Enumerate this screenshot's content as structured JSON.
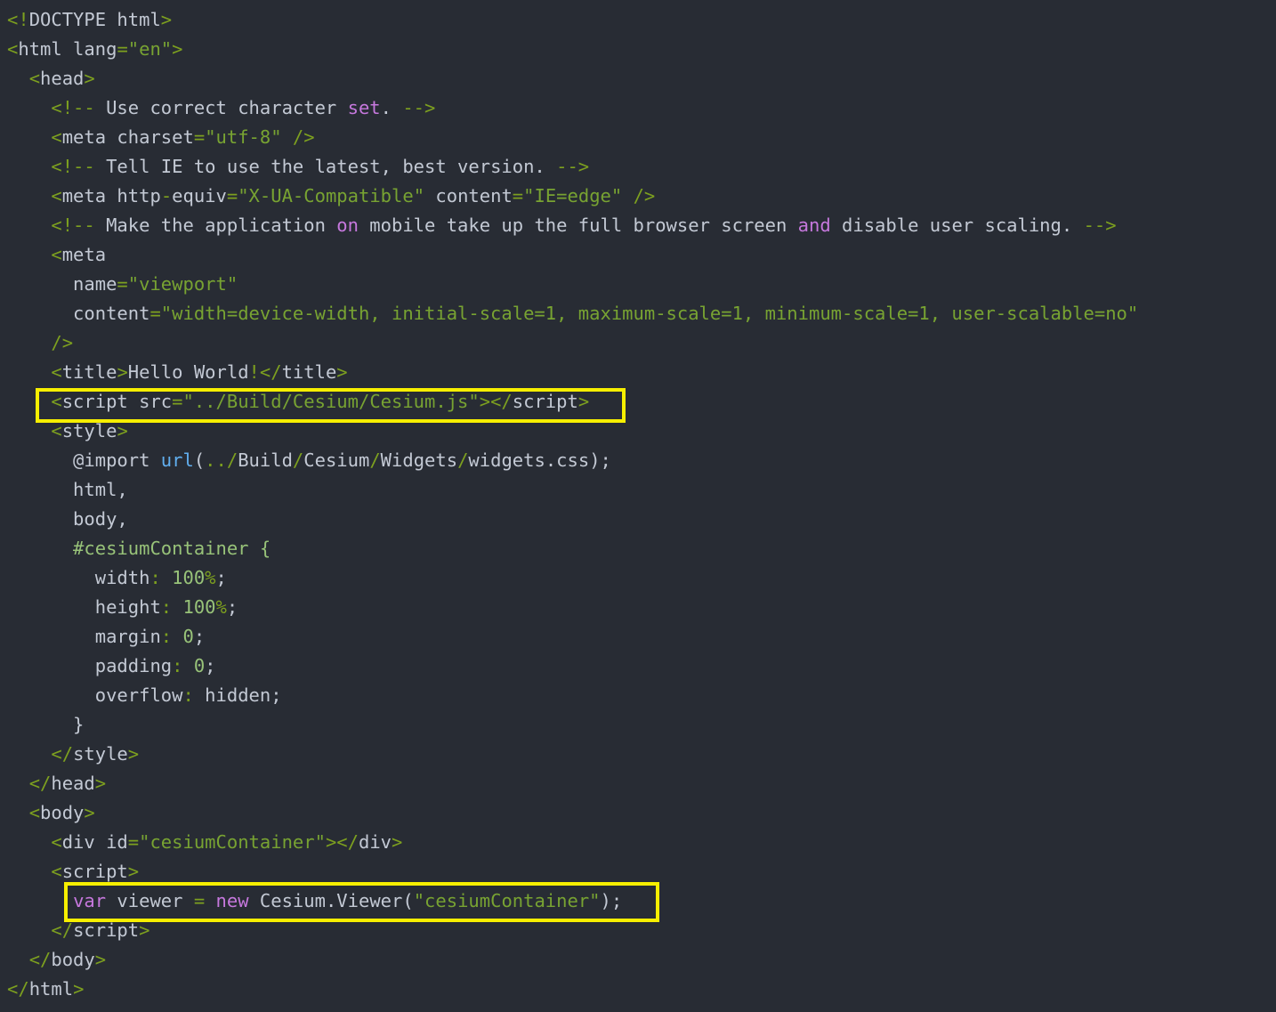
{
  "editor": {
    "background": "#282c34",
    "highlight_color": "#f7ef00",
    "lines": [
      [
        [
          "<!",
          "punct"
        ],
        [
          "DOCTYPE html",
          "text"
        ],
        [
          ">",
          "punct"
        ]
      ],
      [
        [
          "<",
          "punct"
        ],
        [
          "html",
          "text"
        ],
        [
          " lang",
          "text"
        ],
        [
          "=",
          "punct"
        ],
        [
          "\"en\"",
          "string"
        ],
        [
          ">",
          "punct"
        ]
      ],
      [
        [
          "  ",
          "text"
        ],
        [
          "<",
          "punct"
        ],
        [
          "head",
          "text"
        ],
        [
          ">",
          "punct"
        ]
      ],
      [
        [
          "    ",
          "text"
        ],
        [
          "<!--",
          "punct"
        ],
        [
          " Use correct character ",
          "text"
        ],
        [
          "set",
          "keyword"
        ],
        [
          ". ",
          "text"
        ],
        [
          "-->",
          "punct"
        ]
      ],
      [
        [
          "    ",
          "text"
        ],
        [
          "<",
          "punct"
        ],
        [
          "meta",
          "text"
        ],
        [
          " charset",
          "text"
        ],
        [
          "=",
          "punct"
        ],
        [
          "\"utf-8\"",
          "string"
        ],
        [
          " />",
          "punct"
        ]
      ],
      [
        [
          "    ",
          "text"
        ],
        [
          "<!--",
          "punct"
        ],
        [
          " Tell IE to use the latest, best version. ",
          "text"
        ],
        [
          "-->",
          "punct"
        ]
      ],
      [
        [
          "    ",
          "text"
        ],
        [
          "<",
          "punct"
        ],
        [
          "meta",
          "text"
        ],
        [
          " http",
          "text"
        ],
        [
          "-",
          "punct"
        ],
        [
          "equiv",
          "text"
        ],
        [
          "=",
          "punct"
        ],
        [
          "\"X-UA-Compatible\"",
          "string"
        ],
        [
          " content",
          "text"
        ],
        [
          "=",
          "punct"
        ],
        [
          "\"IE=edge\"",
          "string"
        ],
        [
          " />",
          "punct"
        ]
      ],
      [
        [
          "    ",
          "text"
        ],
        [
          "<!--",
          "punct"
        ],
        [
          " Make the application ",
          "text"
        ],
        [
          "on",
          "keyword"
        ],
        [
          " mobile take up the full browser screen ",
          "text"
        ],
        [
          "and",
          "keyword"
        ],
        [
          " disable user scaling. ",
          "text"
        ],
        [
          "-->",
          "punct"
        ]
      ],
      [
        [
          "    ",
          "text"
        ],
        [
          "<",
          "punct"
        ],
        [
          "meta",
          "text"
        ]
      ],
      [
        [
          "      name",
          "text"
        ],
        [
          "=",
          "punct"
        ],
        [
          "\"viewport\"",
          "string"
        ]
      ],
      [
        [
          "      content",
          "text"
        ],
        [
          "=",
          "punct"
        ],
        [
          "\"width=device-width, initial-scale=1, maximum-scale=1, minimum-scale=1, user-scalable=no\"",
          "string"
        ]
      ],
      [
        [
          "    ",
          "text"
        ],
        [
          "/>",
          "punct"
        ]
      ],
      [
        [
          "    ",
          "text"
        ],
        [
          "<",
          "punct"
        ],
        [
          "title",
          "text"
        ],
        [
          ">",
          "punct"
        ],
        [
          "Hello World",
          "text"
        ],
        [
          "!",
          "punct"
        ],
        [
          "</",
          "punct"
        ],
        [
          "title",
          "text"
        ],
        [
          ">",
          "punct"
        ]
      ],
      [
        [
          "    ",
          "text"
        ],
        [
          "<",
          "punct"
        ],
        [
          "script",
          "text"
        ],
        [
          " src",
          "text"
        ],
        [
          "=",
          "punct"
        ],
        [
          "\"../Build/Cesium/Cesium.js\"",
          "string"
        ],
        [
          "></",
          "punct"
        ],
        [
          "script",
          "text"
        ],
        [
          ">",
          "punct"
        ]
      ],
      [
        [
          "    ",
          "text"
        ],
        [
          "<",
          "punct"
        ],
        [
          "style",
          "text"
        ],
        [
          ">",
          "punct"
        ]
      ],
      [
        [
          "      @import ",
          "text"
        ],
        [
          "url",
          "func"
        ],
        [
          "(",
          "text"
        ],
        [
          "../",
          "punct"
        ],
        [
          "Build",
          "text"
        ],
        [
          "/",
          "punct"
        ],
        [
          "Cesium",
          "text"
        ],
        [
          "/",
          "punct"
        ],
        [
          "Widgets",
          "text"
        ],
        [
          "/",
          "punct"
        ],
        [
          "widgets.css",
          "text"
        ],
        [
          ");",
          "text"
        ]
      ],
      [
        [
          "      html,",
          "text"
        ]
      ],
      [
        [
          "      body,",
          "text"
        ]
      ],
      [
        [
          "      #cesiumContainer {",
          "selector"
        ]
      ],
      [
        [
          "        width",
          "text"
        ],
        [
          ": ",
          "punct"
        ],
        [
          "100",
          "number"
        ],
        [
          "%",
          "punct"
        ],
        [
          ";",
          "text"
        ]
      ],
      [
        [
          "        height",
          "text"
        ],
        [
          ": ",
          "punct"
        ],
        [
          "100",
          "number"
        ],
        [
          "%",
          "punct"
        ],
        [
          ";",
          "text"
        ]
      ],
      [
        [
          "        margin",
          "text"
        ],
        [
          ": ",
          "punct"
        ],
        [
          "0",
          "number"
        ],
        [
          ";",
          "text"
        ]
      ],
      [
        [
          "        padding",
          "text"
        ],
        [
          ": ",
          "punct"
        ],
        [
          "0",
          "number"
        ],
        [
          ";",
          "text"
        ]
      ],
      [
        [
          "        overflow",
          "text"
        ],
        [
          ": ",
          "punct"
        ],
        [
          "hidden",
          "text"
        ],
        [
          ";",
          "text"
        ]
      ],
      [
        [
          "      }",
          "text"
        ]
      ],
      [
        [
          "    ",
          "text"
        ],
        [
          "</",
          "punct"
        ],
        [
          "style",
          "text"
        ],
        [
          ">",
          "punct"
        ]
      ],
      [
        [
          "  ",
          "text"
        ],
        [
          "</",
          "punct"
        ],
        [
          "head",
          "text"
        ],
        [
          ">",
          "punct"
        ]
      ],
      [
        [
          "  ",
          "text"
        ],
        [
          "<",
          "punct"
        ],
        [
          "body",
          "text"
        ],
        [
          ">",
          "punct"
        ]
      ],
      [
        [
          "    ",
          "text"
        ],
        [
          "<",
          "punct"
        ],
        [
          "div",
          "text"
        ],
        [
          " id",
          "text"
        ],
        [
          "=",
          "punct"
        ],
        [
          "\"cesiumContainer\"",
          "string"
        ],
        [
          "></",
          "punct"
        ],
        [
          "div",
          "text"
        ],
        [
          ">",
          "punct"
        ]
      ],
      [
        [
          "    ",
          "text"
        ],
        [
          "<",
          "punct"
        ],
        [
          "script",
          "text"
        ],
        [
          ">",
          "punct"
        ]
      ],
      [
        [
          "      ",
          "text"
        ],
        [
          "var",
          "keyword"
        ],
        [
          " viewer ",
          "text"
        ],
        [
          "=",
          "punct"
        ],
        [
          " ",
          "text"
        ],
        [
          "new",
          "keyword"
        ],
        [
          " Cesium.Viewer(",
          "text"
        ],
        [
          "\"cesiumContainer\"",
          "string"
        ],
        [
          ");",
          "text"
        ]
      ],
      [
        [
          "    ",
          "text"
        ],
        [
          "</",
          "punct"
        ],
        [
          "script",
          "text"
        ],
        [
          ">",
          "punct"
        ]
      ],
      [
        [
          "  ",
          "text"
        ],
        [
          "</",
          "punct"
        ],
        [
          "body",
          "text"
        ],
        [
          ">",
          "punct"
        ]
      ],
      [
        [
          "</",
          "punct"
        ],
        [
          "html",
          "text"
        ],
        [
          ">",
          "punct"
        ]
      ]
    ]
  }
}
